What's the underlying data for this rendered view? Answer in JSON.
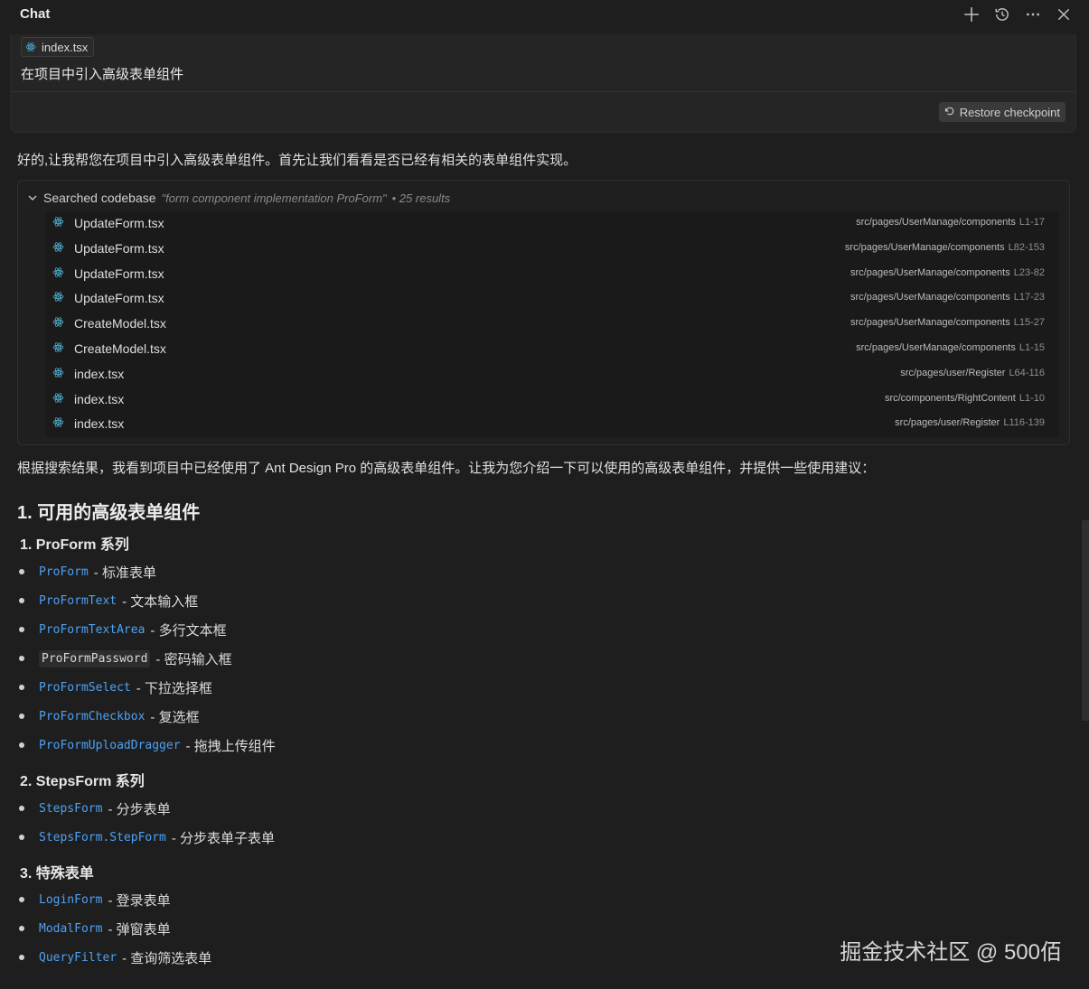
{
  "header": {
    "title": "Chat"
  },
  "user_message": {
    "file_chip": "index.tsx",
    "text": "在项目中引入高级表单组件",
    "restore_label": "Restore checkpoint"
  },
  "reply_intro": "好的,让我帮您在项目中引入高级表单组件。首先让我们看看是否已经有相关的表单组件实现。",
  "search": {
    "label": "Searched codebase",
    "query": "\"form component implementation ProForm\"",
    "count": "• 25 results",
    "results": [
      {
        "file": "UpdateForm.tsx",
        "path": "src/pages/UserManage/components",
        "range": "L1-17"
      },
      {
        "file": "UpdateForm.tsx",
        "path": "src/pages/UserManage/components",
        "range": "L82-153"
      },
      {
        "file": "UpdateForm.tsx",
        "path": "src/pages/UserManage/components",
        "range": "L23-82"
      },
      {
        "file": "UpdateForm.tsx",
        "path": "src/pages/UserManage/components",
        "range": "L17-23"
      },
      {
        "file": "CreateModel.tsx",
        "path": "src/pages/UserManage/components",
        "range": "L15-27"
      },
      {
        "file": "CreateModel.tsx",
        "path": "src/pages/UserManage/components",
        "range": "L1-15"
      },
      {
        "file": "index.tsx",
        "path": "src/pages/user/Register",
        "range": "L64-116"
      },
      {
        "file": "index.tsx",
        "path": "src/components/RightContent",
        "range": "L1-10"
      },
      {
        "file": "index.tsx",
        "path": "src/pages/user/Register",
        "range": "L116-139"
      }
    ]
  },
  "analysis_text": "根据搜索结果，我看到项目中已经使用了 Ant Design Pro 的高级表单组件。让我为您介绍一下可以使用的高级表单组件，并提供一些使用建议：",
  "section_heading": "1. 可用的高级表单组件",
  "groups": [
    {
      "title": "1. ProForm 系列",
      "items": [
        {
          "code": "ProForm",
          "desc": "- 标准表单"
        },
        {
          "code": "ProFormText",
          "desc": "- 文本输入框"
        },
        {
          "code": "ProFormTextArea",
          "desc": "- 多行文本框"
        },
        {
          "code": "ProFormPassword",
          "desc": "- 密码输入框"
        },
        {
          "code": "ProFormSelect",
          "desc": "- 下拉选择框"
        },
        {
          "code": "ProFormCheckbox",
          "desc": "- 复选框"
        },
        {
          "code": "ProFormUploadDragger",
          "desc": "- 拖拽上传组件"
        }
      ]
    },
    {
      "title": "2. StepsForm 系列",
      "items": [
        {
          "code": "StepsForm",
          "desc": "- 分步表单"
        },
        {
          "code": "StepsForm.StepForm",
          "desc": "- 分步表单子表单"
        }
      ]
    },
    {
      "title": "3. 特殊表单",
      "items": [
        {
          "code": "LoginForm",
          "desc": "- 登录表单"
        },
        {
          "code": "ModalForm",
          "desc": "- 弹窗表单"
        },
        {
          "code": "QueryFilter",
          "desc": "- 查询筛选表单"
        }
      ]
    }
  ],
  "watermark": "掘金技术社区 @ 500佰",
  "colors": {
    "background": "#1e1e1e",
    "code_link": "#4ea1f3"
  },
  "icons": [
    "plus-icon",
    "history-icon",
    "more-icon",
    "close-icon",
    "react-icon",
    "chevron-down-icon",
    "restore-icon"
  ]
}
